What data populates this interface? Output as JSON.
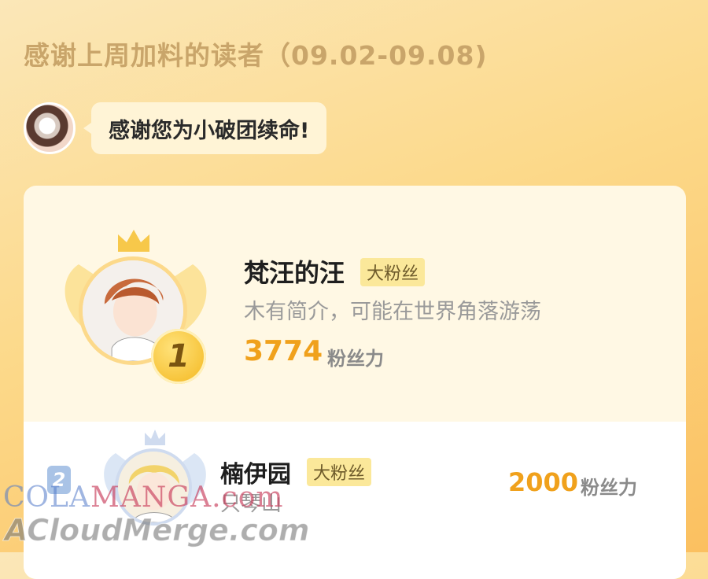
{
  "page_title": "感谢上周加料的读者（09.02-09.08)",
  "speech": "感谢您为小破团续命!",
  "leaders": [
    {
      "rank": "1",
      "name": "梵汪的汪",
      "tag": "大粉丝",
      "bio": "木有简介，可能在世界角落游荡",
      "score": "3774",
      "unit": "粉丝力"
    },
    {
      "rank": "2",
      "name": "楠伊园",
      "tag": "大粉丝",
      "bio": "只琴山",
      "score": "2000",
      "unit": "粉丝力"
    }
  ],
  "watermarks": {
    "line1_a": "COLA",
    "line1_b": "MANGA",
    "line1_c": ".com",
    "line2": "ACloudMerge.com"
  },
  "colors": {
    "accent": "#f0a11c",
    "gold": "#fcd98a",
    "silver": "#a9c3e6"
  }
}
